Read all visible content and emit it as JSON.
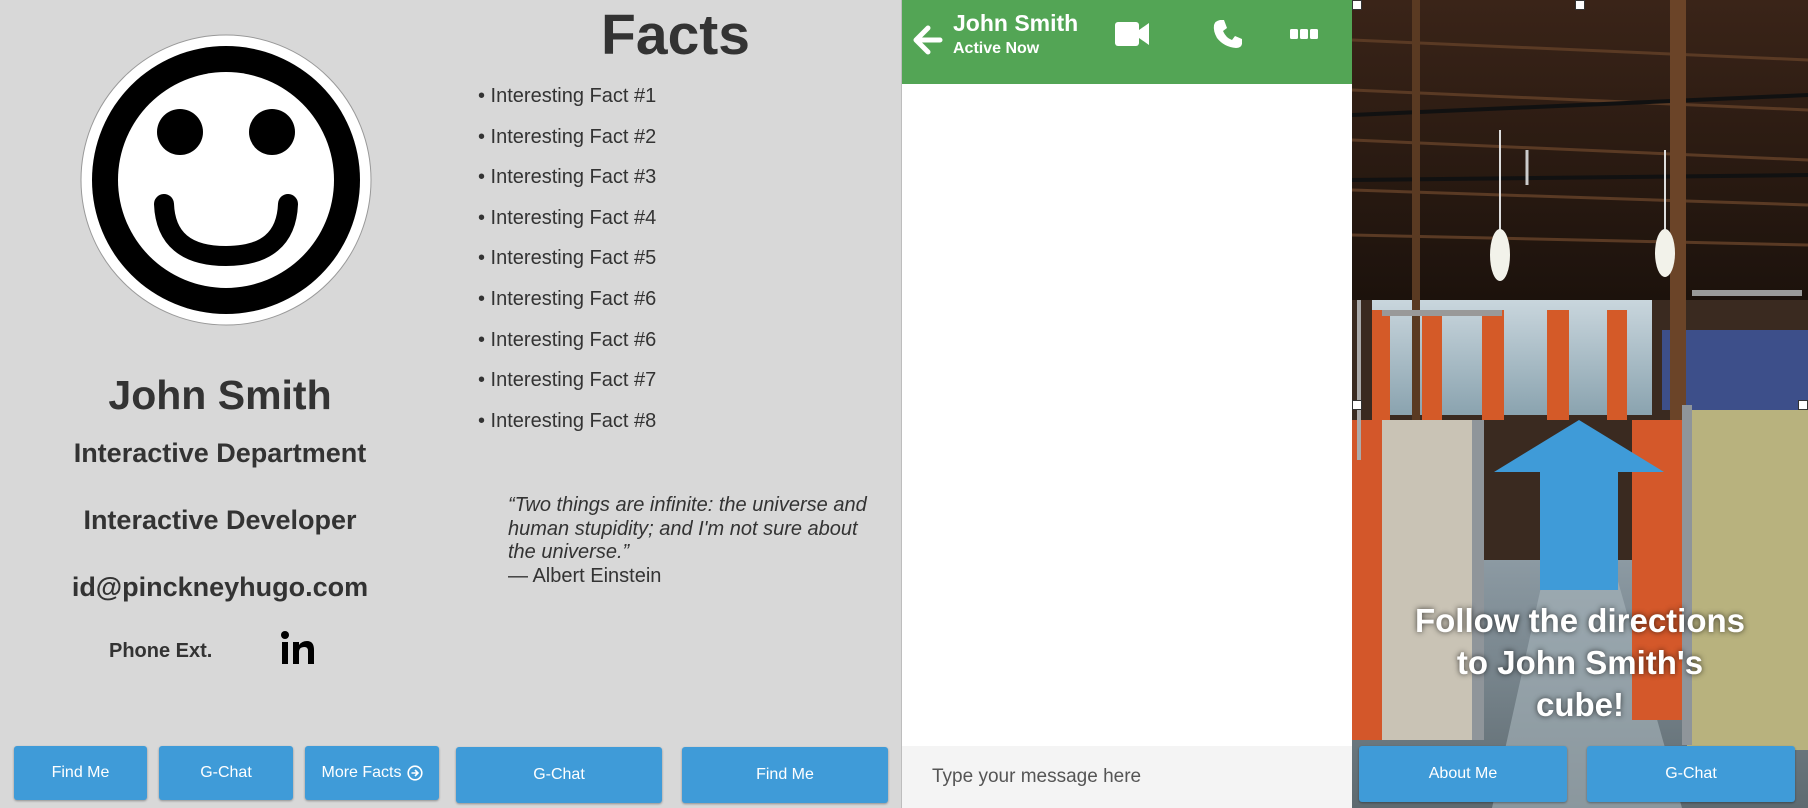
{
  "profile": {
    "name": "John Smith",
    "department": "Interactive Department",
    "role": "Interactive Developer",
    "email": "id@pinckneyhugo.com",
    "phone_label": "Phone Ext.",
    "linkedin_icon": "linkedin-icon",
    "buttons": {
      "find_me": "Find Me",
      "gchat": "G-Chat",
      "more_facts": "More Facts"
    }
  },
  "facts": {
    "title": "Facts",
    "items": [
      "• Interesting Fact #1",
      "• Interesting Fact #2",
      "• Interesting Fact #3",
      "• Interesting Fact #4",
      "• Interesting Fact #5",
      "• Interesting Fact #6",
      "• Interesting Fact #6",
      "• Interesting Fact #7",
      "• Interesting Fact #8"
    ],
    "quote": "“Two things are infinite: the universe and human stupidity; and I'm not sure about the universe.”",
    "quote_author": "— Albert Einstein",
    "buttons": {
      "gchat": "G-Chat",
      "find_me": "Find Me"
    }
  },
  "chat": {
    "name": "John Smith",
    "status": "Active Now",
    "input_placeholder": "Type your message here",
    "header_color": "#53a555"
  },
  "directions": {
    "message": "Follow the directions to John Smith's cube!",
    "buttons": {
      "about_me": "About Me",
      "gchat": "G-Chat"
    }
  },
  "colors": {
    "button": "#3f9bd8",
    "panel_bg": "#d8d8d8",
    "text": "#333333"
  }
}
